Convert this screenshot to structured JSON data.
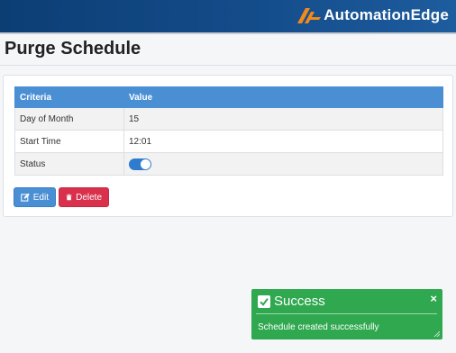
{
  "header": {
    "brand": "AutomationEdge",
    "logo_icon": "automationedge-logo-icon",
    "brand_colors": {
      "orange": "#f28a1a",
      "bar": "#144c8a"
    }
  },
  "page": {
    "title": "Purge Schedule"
  },
  "table": {
    "columns": [
      "Criteria",
      "Value"
    ],
    "rows": [
      {
        "criteria": "Day of Month",
        "value": "15"
      },
      {
        "criteria": "Start Time",
        "value": "12:01"
      },
      {
        "criteria": "Status",
        "value_toggle": true
      }
    ],
    "header_color": "#4a8fd4"
  },
  "actions": {
    "edit_label": "Edit",
    "edit_icon": "edit-icon",
    "delete_label": "Delete",
    "delete_icon": "trash-icon",
    "edit_color": "#4a8fd4",
    "delete_color": "#d9304c"
  },
  "toast": {
    "title": "Success",
    "message": "Schedule created successfully",
    "close_label": "×",
    "check_icon": "check-square-icon",
    "color": "#2fa84f"
  }
}
